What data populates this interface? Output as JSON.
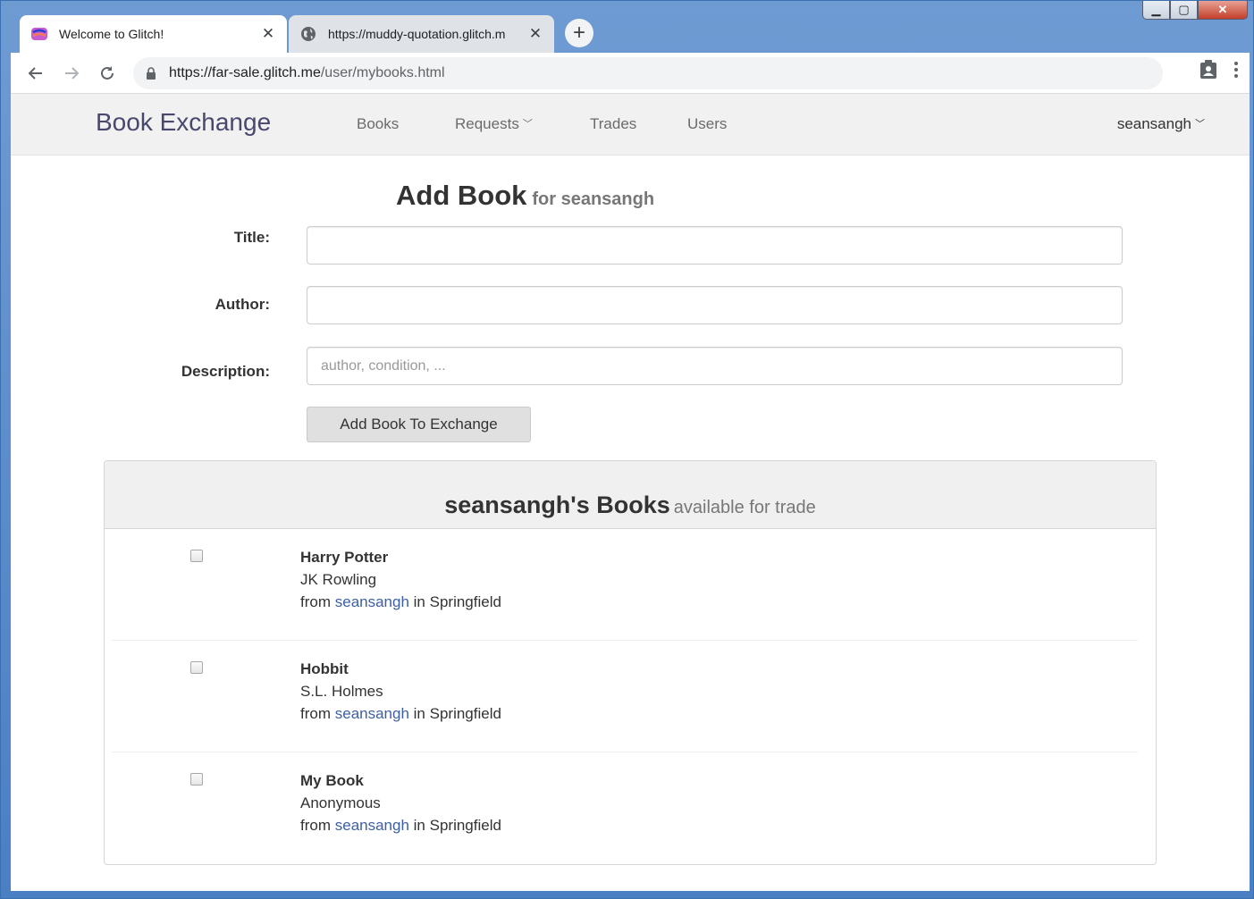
{
  "browser": {
    "tabs": [
      {
        "title": "Welcome to Glitch!",
        "icon": "glitch-icon",
        "active": true
      },
      {
        "title": "https://muddy-quotation.glitch.m",
        "icon": "globe-icon",
        "active": false
      }
    ],
    "new_tab_icon": "plus-icon",
    "url_host": "https://far-sale.glitch.me",
    "url_path": "/user/mybooks.html"
  },
  "navbar": {
    "brand": "Book Exchange",
    "links": {
      "books": "Books",
      "requests": "Requests",
      "trades": "Trades",
      "users": "Users"
    },
    "user": "seansangh"
  },
  "add_book": {
    "heading": "Add Book",
    "subheading": "for seansangh",
    "title_label": "Title:",
    "author_label": "Author:",
    "description_label": "Description:",
    "title_value": "",
    "author_value": "",
    "description_value": "",
    "description_placeholder": "author, condition, ...",
    "submit_label": "Add Book To Exchange"
  },
  "books_panel": {
    "heading": "seansangh's Books",
    "subheading": "available for trade",
    "from_word": "from",
    "in_word": "in",
    "books": [
      {
        "title": "Harry Potter",
        "author": "JK Rowling",
        "owner": "seansangh",
        "location": "Springfield",
        "checked": false
      },
      {
        "title": "Hobbit",
        "author": "S.L. Holmes",
        "owner": "seansangh",
        "location": "Springfield",
        "checked": false
      },
      {
        "title": "My Book",
        "author": "Anonymous",
        "owner": "seansangh",
        "location": "Springfield",
        "checked": false
      }
    ]
  },
  "colors": {
    "brand": "#48486e",
    "link": "#3d5fa3",
    "navbar_bg": "#f1f1f1"
  }
}
